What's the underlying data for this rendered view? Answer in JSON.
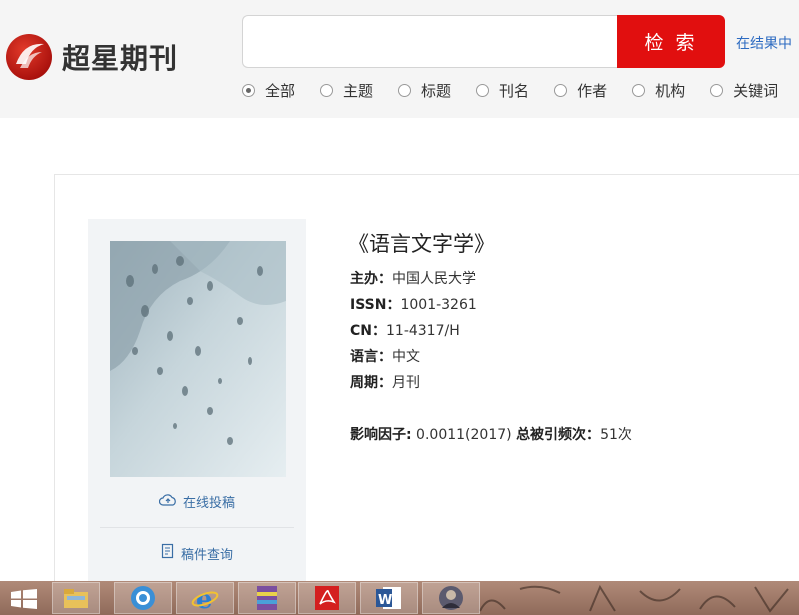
{
  "header": {
    "logo_text": "超星期刊",
    "search_button_label": "检 索",
    "search_value": "",
    "in_results_label": "在结果中",
    "filter_options": [
      {
        "label": "全部",
        "selected": true
      },
      {
        "label": "主题",
        "selected": false
      },
      {
        "label": "标题",
        "selected": false
      },
      {
        "label": "刊名",
        "selected": false
      },
      {
        "label": "作者",
        "selected": false
      },
      {
        "label": "机构",
        "selected": false
      },
      {
        "label": "关键词",
        "selected": false
      }
    ]
  },
  "journal": {
    "title": "《语言文字学》",
    "sponsor_label": "主办：",
    "sponsor": "中国人民大学",
    "issn_label": "ISSN：",
    "issn": "1001-3261",
    "cn_label": "CN：",
    "cn": "11-4317/H",
    "language_label": "语言：",
    "language": "中文",
    "period_label": "周期：",
    "period": "月刊",
    "impact_label": "影响因子:",
    "impact_value": " 0.0011(2017) ",
    "citations_label": "总被引频次：",
    "citations_value": "51次"
  },
  "side_links": {
    "submit_online": "在线投稿",
    "manuscript_query": "稿件查询"
  },
  "taskbar": {
    "apps": [
      "windows-start",
      "file-explorer",
      "browser",
      "internet-explorer",
      "winrar",
      "acrobat",
      "word",
      "photo"
    ]
  },
  "colors": {
    "accent_red": "#e10f0f",
    "link_blue": "#2d6bc1",
    "header_bg": "#f5f5f5"
  }
}
